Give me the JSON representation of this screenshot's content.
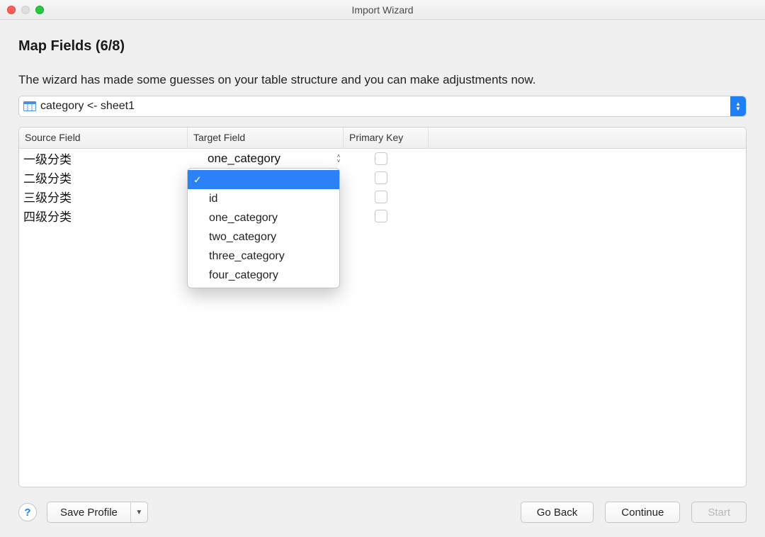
{
  "window": {
    "title": "Import Wizard"
  },
  "step": {
    "title": "Map Fields (6/8)",
    "subtitle": "The wizard has made some guesses on your table structure and you can make adjustments now."
  },
  "mappingSelector": {
    "value": "category <- sheet1"
  },
  "columns": {
    "source": "Source Field",
    "target": "Target Field",
    "pk": "Primary Key"
  },
  "rows": [
    {
      "source": "一级分类",
      "target": "one_category"
    },
    {
      "source": "二级分类",
      "target": ""
    },
    {
      "source": "三级分类",
      "target": ""
    },
    {
      "source": "四级分类",
      "target": ""
    }
  ],
  "dropdown": {
    "options": [
      "",
      "id",
      "one_category",
      "two_category",
      "three_category",
      "four_category"
    ],
    "selectedIndex": 0
  },
  "footer": {
    "help": "?",
    "saveProfile": "Save Profile",
    "goBack": "Go Back",
    "continue": "Continue",
    "start": "Start"
  }
}
